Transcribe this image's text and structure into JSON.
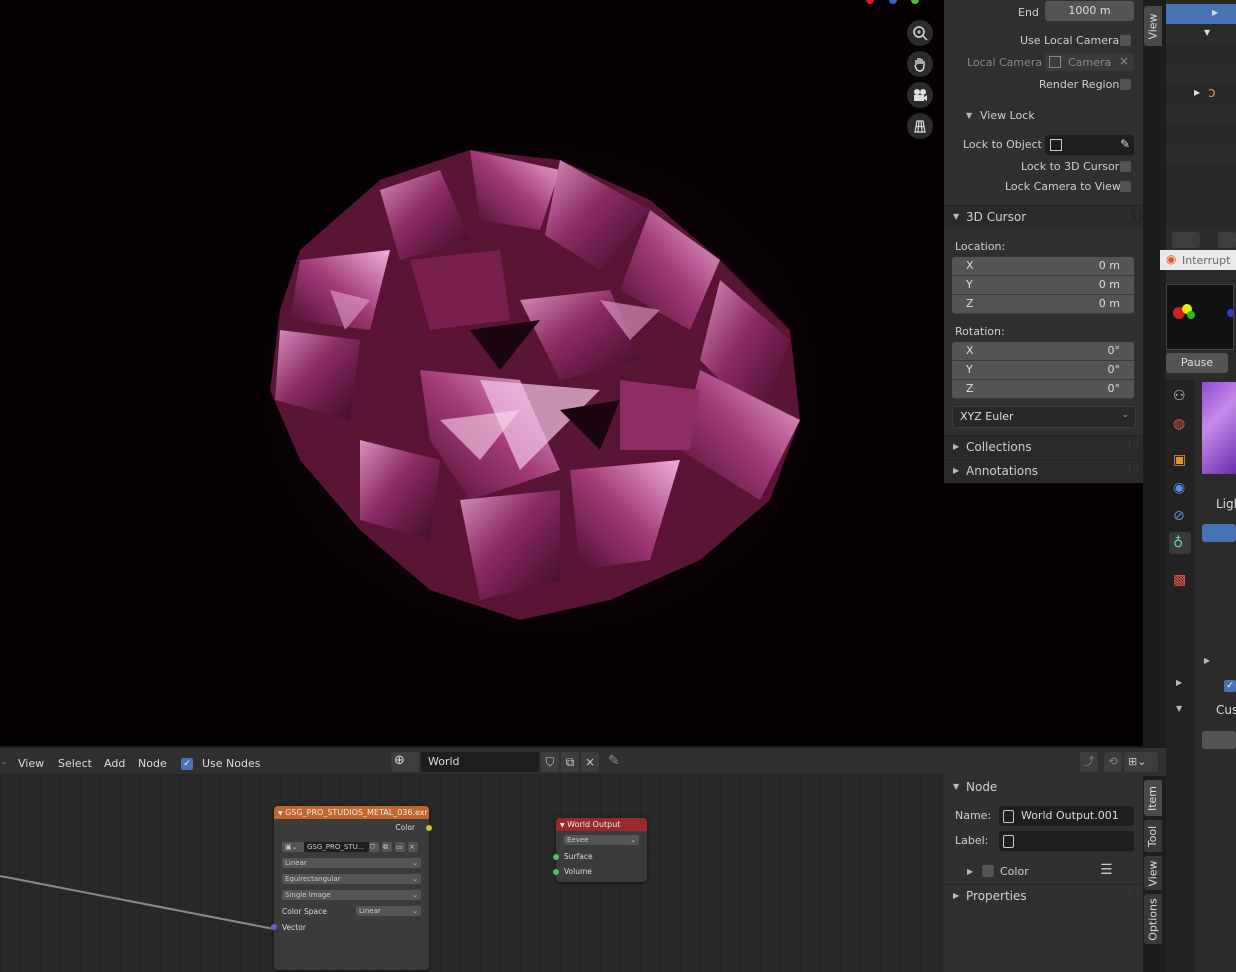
{
  "viewport": {
    "nav_icons": [
      "zoom-icon",
      "hand-pan-icon",
      "camera-icon",
      "grid-ortho-icon"
    ]
  },
  "n_panel": {
    "end_label": "End",
    "end_value": "1000 m",
    "use_local_camera": "Use Local Camera",
    "local_camera": "Local Camera",
    "camera_value": "Camera",
    "render_region": "Render Region",
    "view_lock_title": "View Lock",
    "lock_to_object": "Lock to Object",
    "lock_to_3d_cursor": "Lock to 3D Cursor",
    "lock_camera_to_view": "Lock Camera to View",
    "cursor_title": "3D Cursor",
    "location_label": "Location:",
    "location": [
      {
        "axis": "X",
        "value": "0 m"
      },
      {
        "axis": "Y",
        "value": "0 m"
      },
      {
        "axis": "Z",
        "value": "0 m"
      }
    ],
    "rotation_label": "Rotation:",
    "rotation": [
      {
        "axis": "X",
        "value": "0°"
      },
      {
        "axis": "Y",
        "value": "0°"
      },
      {
        "axis": "Z",
        "value": "0°"
      }
    ],
    "rotation_mode": "XYZ Euler",
    "collections": "Collections",
    "annotations": "Annotations",
    "tab_view": "View"
  },
  "right_side": {
    "interrupt": "Interrupt",
    "pause": "Pause",
    "ligh": "Ligh",
    "cus": "Cus"
  },
  "node_header": {
    "view": "View",
    "select": "Select",
    "add": "Add",
    "node": "Node",
    "use_nodes": "Use Nodes",
    "world_name": "World"
  },
  "image_node": {
    "title": "GSG_PRO_STUDIOS_METAL_036.exr",
    "color_out": "Color",
    "image_name": "GSG_PRO_STU...",
    "interpolation": "Linear",
    "projection": "Equirectangular",
    "source": "Single Image",
    "color_space_label": "Color Space",
    "color_space": "Linear",
    "vector_in": "Vector"
  },
  "output_node": {
    "title": "World Output",
    "target": "Eevee",
    "surface": "Surface",
    "volume": "Volume"
  },
  "node_sidebar": {
    "node_title": "Node",
    "name_label": "Name:",
    "name_value": "World Output.001",
    "label_label": "Label:",
    "label_value": "",
    "color": "Color",
    "properties": "Properties",
    "tabs": [
      "Item",
      "Tool",
      "View",
      "Options"
    ]
  }
}
